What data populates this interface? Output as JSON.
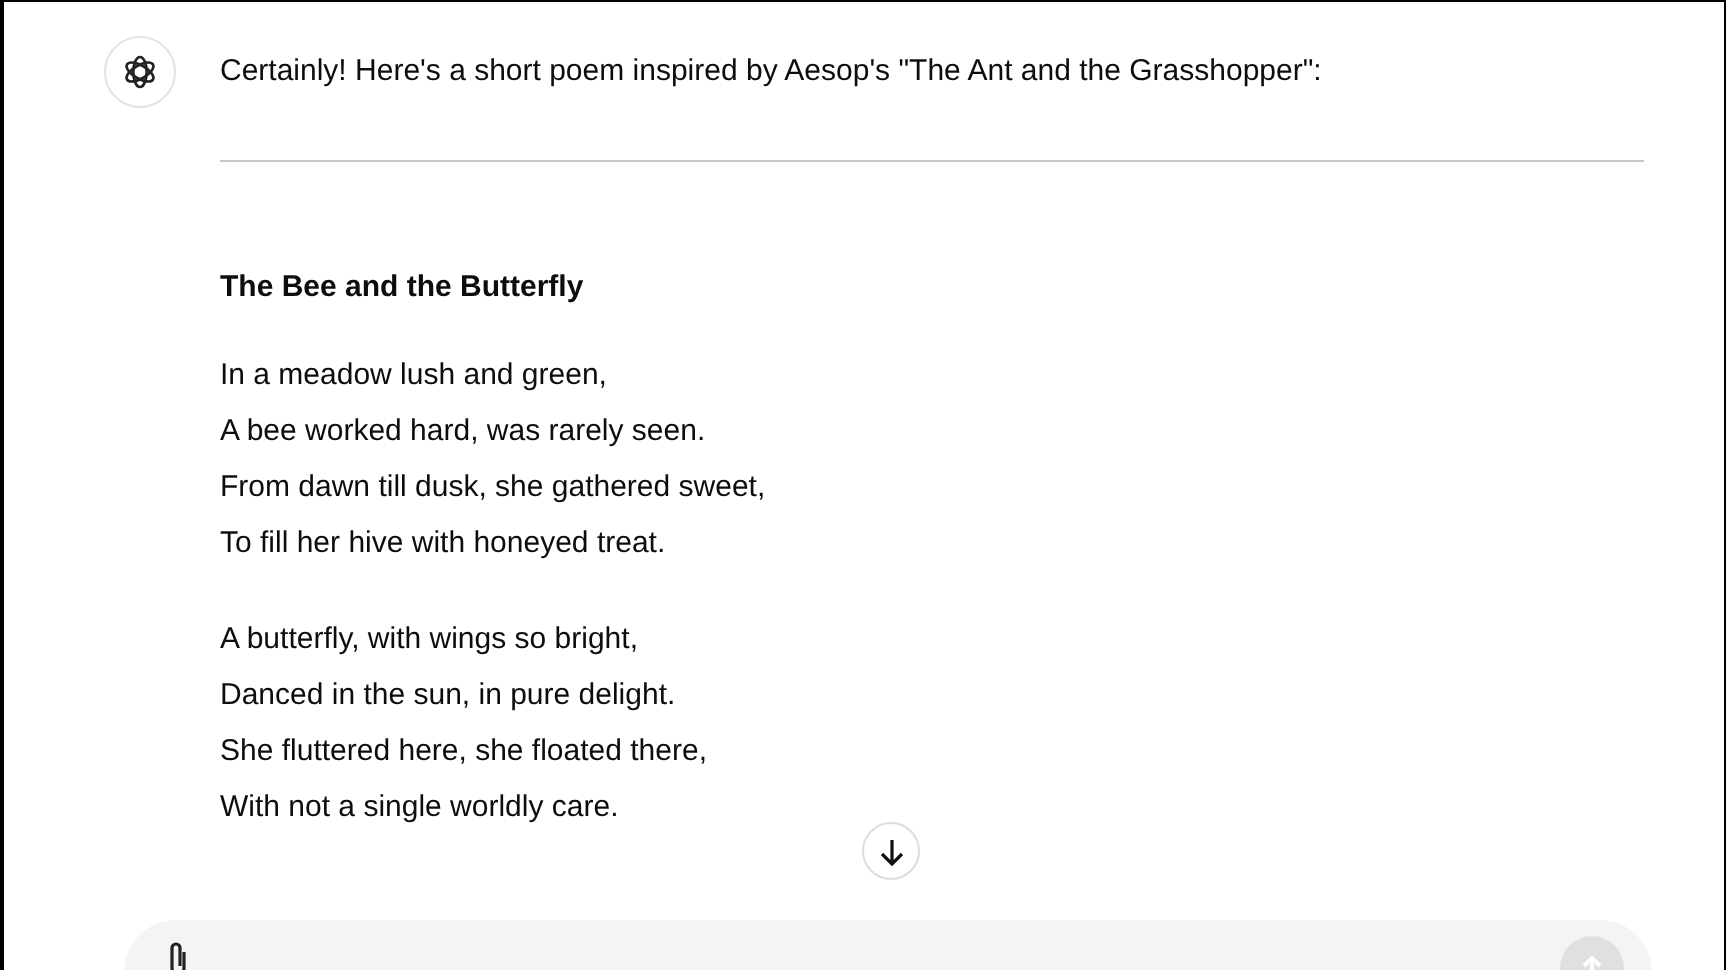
{
  "message": {
    "intro": "Certainly! Here's a short poem inspired by Aesop's \"The Ant and the Grasshopper\":",
    "poem_title": "The Bee and the Butterfly",
    "stanzas": [
      [
        "In a meadow lush and green,",
        "A bee worked hard, was rarely seen.",
        "From dawn till dusk, she gathered sweet,",
        "To fill her hive with honeyed treat."
      ],
      [
        "A butterfly, with wings so bright,",
        "Danced in the sun, in pure delight.",
        "She fluttered here, she floated there,",
        "With not a single worldly care."
      ]
    ]
  }
}
